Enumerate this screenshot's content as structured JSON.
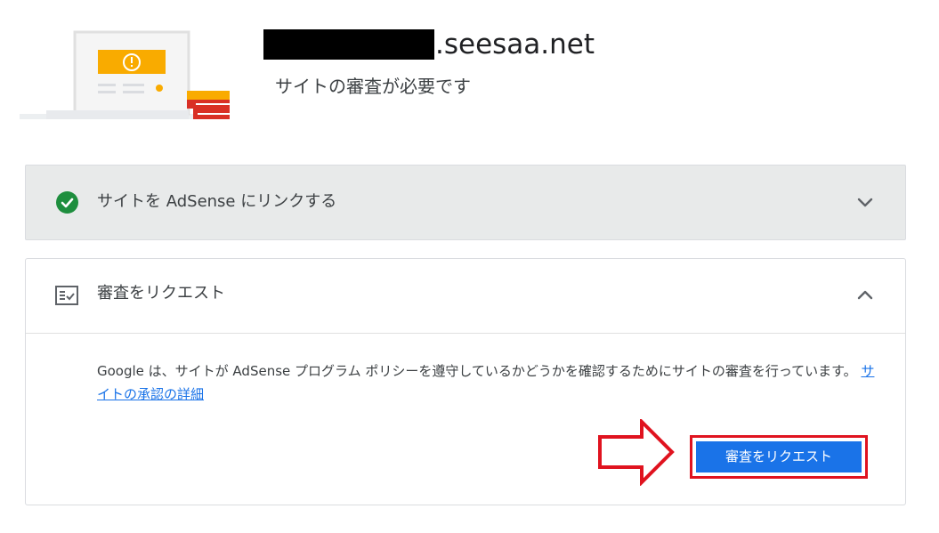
{
  "header": {
    "domain_suffix": ".seesaa.net",
    "subtitle": "サイトの審査が必要です",
    "illustration_icon": "warning-icon"
  },
  "panels": [
    {
      "title": "サイトを AdSense にリンクする",
      "status_icon": "check-circle-icon",
      "expanded": false,
      "status_color": "#1e8e3e"
    },
    {
      "title": "審査をリクエスト",
      "icon": "review-checklist-icon",
      "expanded": true,
      "description": "Google は、サイトが AdSense プログラム ポリシーを遵守しているかどうかを確認するためにサイトの審査を行っています。",
      "link_text": "サイトの承認の詳細",
      "button_label": "審査をリクエスト"
    }
  ],
  "colors": {
    "accent": "#1a73e8",
    "highlight": "#e0131f",
    "collapsed_panel_bg": "#e8eaea"
  }
}
